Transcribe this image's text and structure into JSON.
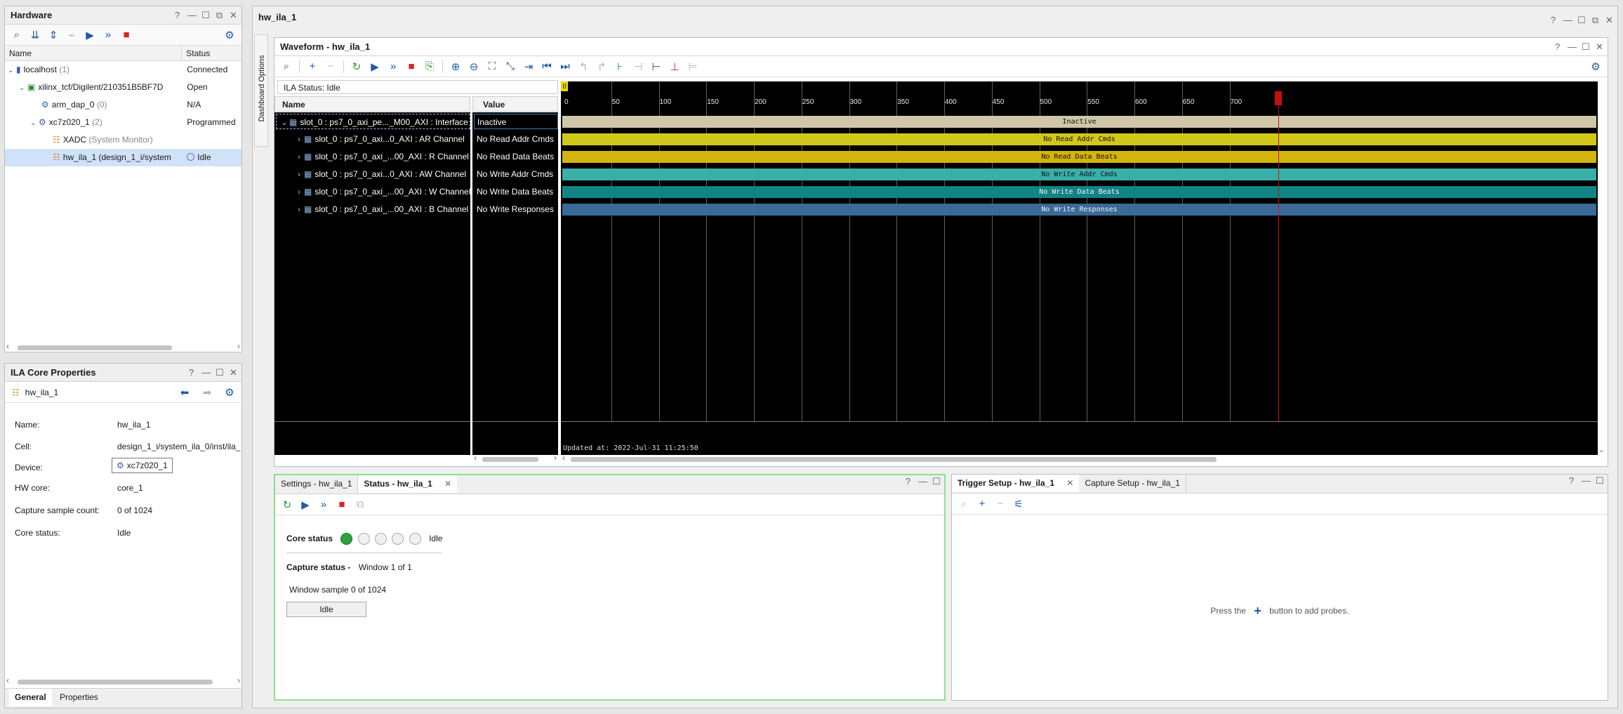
{
  "hardware": {
    "title": "Hardware",
    "columns": [
      "Name",
      "Status"
    ],
    "rows": [
      {
        "name": "localhost",
        "count": "(1)",
        "status": "Connected"
      },
      {
        "name": "xilinx_tcf/Digilent/210351B5BF7D",
        "count": "",
        "status": "Open"
      },
      {
        "name": "arm_dap_0",
        "count": "(0)",
        "status": "N/A"
      },
      {
        "name": "xc7z020_1",
        "count": "(2)",
        "status": "Programmed"
      },
      {
        "name": "XADC",
        "count": "(System Monitor)",
        "status": ""
      },
      {
        "name": "hw_ila_1",
        "count": "(design_1_i/system",
        "status": "Idle"
      }
    ]
  },
  "ila_props": {
    "title": "ILA Core Properties",
    "object": "hw_ila_1",
    "fields": [
      {
        "label": "Name:",
        "value": "hw_ila_1"
      },
      {
        "label": "Cell:",
        "value": "design_1_i/system_ila_0/inst/ila_"
      },
      {
        "label": "Device:",
        "value": "xc7z020_1"
      },
      {
        "label": "HW core:",
        "value": "core_1"
      },
      {
        "label": "Capture sample count:",
        "value": "0 of 1024"
      },
      {
        "label": "Core status:",
        "value": "Idle"
      }
    ],
    "tabs": [
      "General",
      "Properties"
    ]
  },
  "main": {
    "title": "hw_ila_1",
    "side_tab": "Dashboard Options"
  },
  "waveform": {
    "title": "Waveform - hw_ila_1",
    "ila_status": "ILA Status:  Idle",
    "col_name": "Name",
    "col_value": "Value",
    "cursor_label": "0",
    "updated": "Updated at: 2022-Jul-31 11:25:50",
    "ticks": [
      "0",
      "50",
      "100",
      "150",
      "200",
      "250",
      "300",
      "350",
      "400",
      "450",
      "500",
      "550",
      "600",
      "650",
      "700"
    ],
    "rows": [
      {
        "name": "slot_0 : ps7_0_axi_pe..._M00_AXI : Interface",
        "value": "Inactive",
        "bar": "Inactive",
        "color": "#cfc7a8"
      },
      {
        "name": "slot_0 : ps7_0_axi...0_AXI : AR Channel",
        "value": "No Read Addr Cmds",
        "bar": "No Read Addr Cmds",
        "color": "#d2c81a"
      },
      {
        "name": "slot_0 : ps7_0_axi_...00_AXI : R Channel",
        "value": "No Read Data Beats",
        "bar": "No Read Data Beats",
        "color": "#d4b40e"
      },
      {
        "name": "slot_0 : ps7_0_axi...0_AXI : AW Channel",
        "value": "No Write Addr Cmds",
        "bar": "No Write Addr Cmds",
        "color": "#3aaea8"
      },
      {
        "name": "slot_0 : ps7_0_axi_...00_AXI : W Channel",
        "value": "No Write Data Beats",
        "bar": "No Write Data Beats",
        "color": "#128486"
      },
      {
        "name": "slot_0 : ps7_0_axi_...00_AXI : B Channel",
        "value": "No Write Responses",
        "bar": "No Write Responses",
        "color": "#3a6a98"
      }
    ]
  },
  "status_panel": {
    "tabs": [
      "Settings - hw_ila_1",
      "Status - hw_ila_1"
    ],
    "core_status_label": "Core status",
    "core_status_value": "Idle",
    "capture_status_label": "Capture status -",
    "capture_status_value": "Window 1 of 1",
    "window_sample": "Window sample 0 of 1024",
    "idle_button": "Idle"
  },
  "trigger_panel": {
    "tabs": [
      "Trigger Setup - hw_ila_1",
      "Capture Setup - hw_ila_1"
    ],
    "hint_before": "Press the",
    "hint_after": "button to add probes."
  }
}
